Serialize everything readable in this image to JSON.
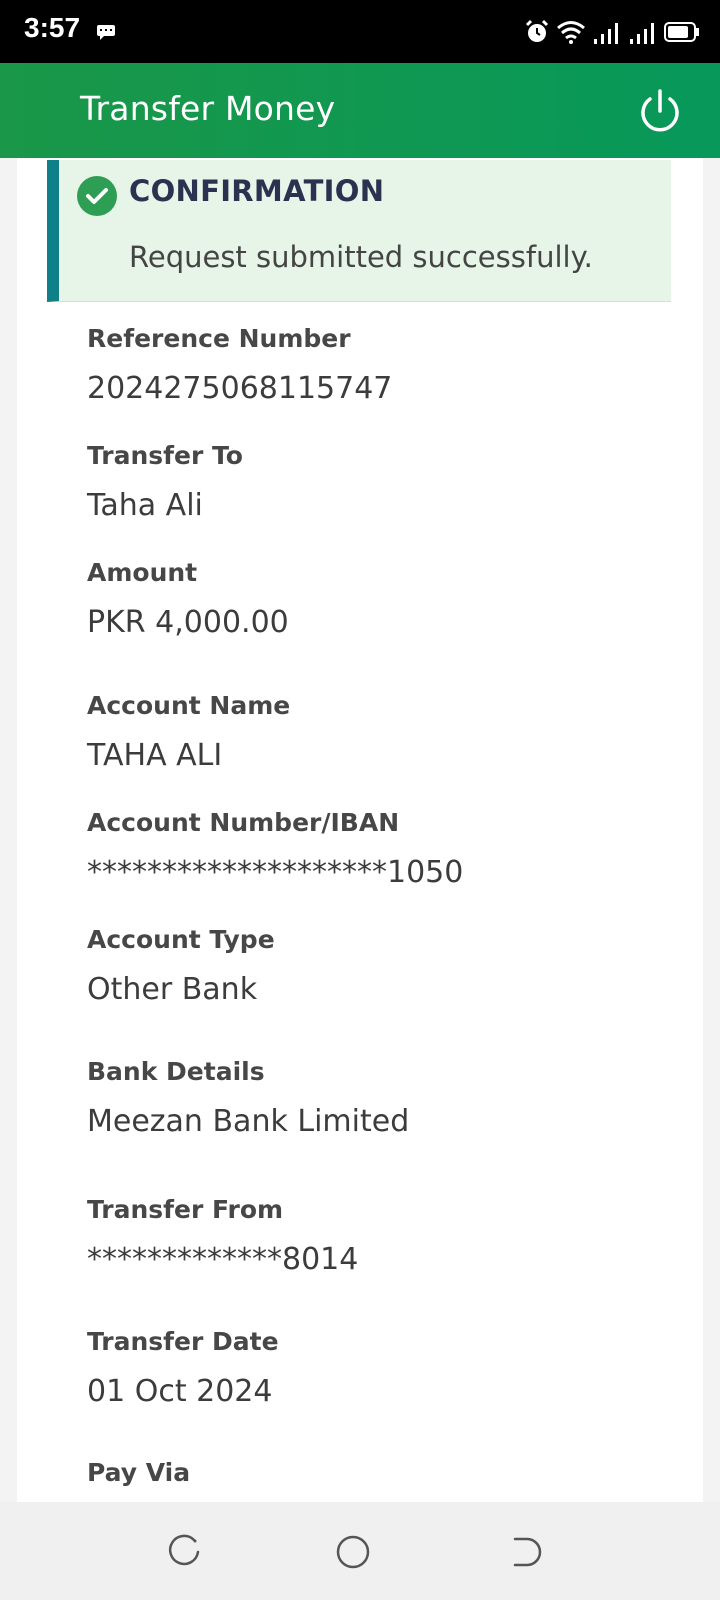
{
  "status_bar": {
    "time": "3:57",
    "icons": [
      "message-icon",
      "alarm-icon",
      "wifi-icon",
      "signal-icon",
      "signal-icon",
      "battery-icon"
    ]
  },
  "app_bar": {
    "title": "Transfer Money",
    "power_icon": "power-icon"
  },
  "confirmation": {
    "title": "CONFIRMATION",
    "message": "Request submitted successfully.",
    "accent_color": "#0f7f88",
    "background_color": "#e6f5e8"
  },
  "details": [
    {
      "label": "Reference Number",
      "value": "2024275068115747"
    },
    {
      "label": "Transfer To",
      "value": "Taha Ali"
    },
    {
      "label": "Amount",
      "value": "PKR 4,000.00"
    },
    {
      "label": "Account Name",
      "value": "TAHA ALI"
    },
    {
      "label": "Account Number/IBAN",
      "value": "********************1050"
    },
    {
      "label": "Account Type",
      "value": "Other Bank"
    },
    {
      "label": "Bank Details",
      "value": "Meezan Bank Limited"
    },
    {
      "label": "Transfer From",
      "value": "*************8014"
    },
    {
      "label": "Transfer Date",
      "value": "01 Oct 2024"
    },
    {
      "label": "Pay Via",
      "value": ""
    }
  ],
  "nav_bar": {
    "buttons": [
      "recent-apps-icon",
      "home-icon",
      "back-icon"
    ]
  },
  "colors": {
    "brand_green": "#1a9748",
    "check_green": "#2e9e55"
  }
}
